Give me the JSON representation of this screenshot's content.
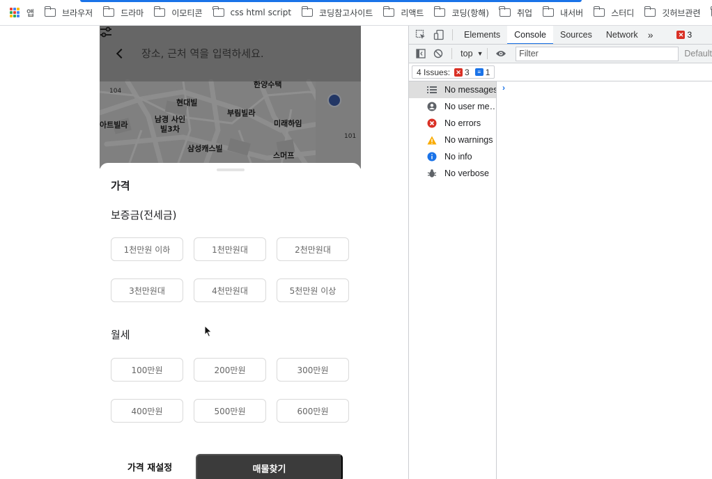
{
  "bookmarks": {
    "apps_label": "앱",
    "folders": [
      "브라우저",
      "드라마",
      "이모티콘",
      "css html script",
      "코딩참고사이트",
      "리액트",
      "코딩(항해)",
      "취업",
      "내서버",
      "스터디",
      "깃허브관련"
    ]
  },
  "search": {
    "placeholder": "장소, 근처 역을 입력하세요."
  },
  "map": {
    "labels": [
      "현대빌",
      "부림빌라",
      "남경 사인빌3차",
      "미래하임",
      "삼성캐스빌",
      "스머프",
      "아트빌라",
      "한양수택"
    ],
    "numbers": [
      "104",
      "101"
    ]
  },
  "sheet": {
    "title": "가격",
    "deposit_title": "보증금(전세금)",
    "deposit_options": [
      "1천만원 이하",
      "1천만원대",
      "2천만원대",
      "3천만원대",
      "4천만원대",
      "5천만원 이상"
    ],
    "monthly_title": "월세",
    "monthly_options": [
      "100만원",
      "200만원",
      "300만원",
      "400만원",
      "500만원",
      "600만원"
    ],
    "reset_label": "가격 재설정",
    "find_label": "매물찾기"
  },
  "devtools": {
    "tabs": [
      "Elements",
      "Console",
      "Sources",
      "Network"
    ],
    "active_tab": "Console",
    "more": "»",
    "error_count_badge": "3",
    "context": "top",
    "filter_placeholder": "Filter",
    "levels_label": "Default",
    "issues_label": "4 Issues:",
    "issues_errors": "3",
    "issues_info": "1",
    "sidebar": [
      {
        "label": "No messages",
        "icon": "list-icon"
      },
      {
        "label": "No user me…",
        "icon": "user-icon"
      },
      {
        "label": "No errors",
        "icon": "error-icon"
      },
      {
        "label": "No warnings",
        "icon": "warning-icon"
      },
      {
        "label": "No info",
        "icon": "info-icon"
      },
      {
        "label": "No verbose",
        "icon": "bug-icon"
      }
    ],
    "prompt": "›"
  },
  "colors": {
    "accent": "#1a73e8",
    "error": "#d93025",
    "warning": "#f9ab00",
    "button_dark": "#3b3b3b"
  }
}
